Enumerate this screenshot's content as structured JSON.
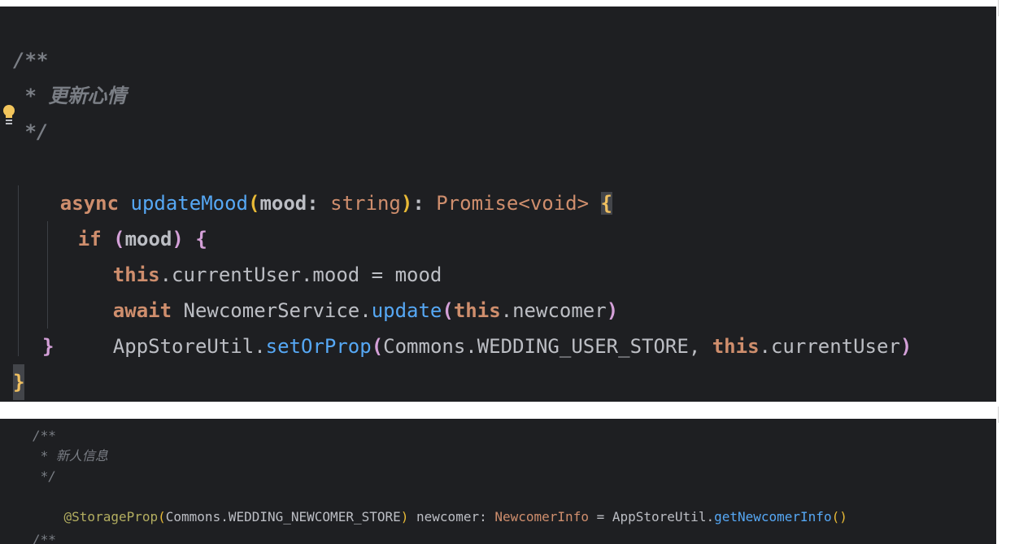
{
  "top": {
    "doc_open": "/**",
    "doc_text": " * 更新心情",
    "doc_close": " */",
    "sig": {
      "async": "async",
      "name": "updateMood",
      "open": "(",
      "param": "mood",
      "colon1": ": ",
      "ptype": "string",
      "close": ")",
      "colon2": ": ",
      "ret": "Promise<void>",
      "brace": "{"
    },
    "if_line": {
      "kw": "if",
      "open": "(",
      "cond": "mood",
      "close": ")",
      "brace": "{"
    },
    "assign": {
      "this": "this",
      "rest": ".currentUser.mood = mood"
    },
    "await_line": {
      "await": "await",
      "obj": " NewcomerService.",
      "fn": "update",
      "open": "(",
      "this": "this",
      "arg": ".newcomer",
      "close": ")"
    },
    "store_line": {
      "obj": "AppStoreUtil.",
      "fn": "setOrProp",
      "open": "(",
      "arg1": "Commons.WEDDING_USER_STORE, ",
      "this": "this",
      "arg2": ".currentUser",
      "close": ")"
    },
    "if_close": "}",
    "fn_close": "}"
  },
  "bottom": {
    "doc_open": "/**",
    "doc_text": " * 新人信息",
    "doc_close": " */",
    "decl": {
      "ann": "@StorageProp",
      "open": "(",
      "arg": "Commons.WEDDING_NEWCOMER_STORE",
      "close": ")",
      "mid": " newcomer: ",
      "type": "NewcomerInfo",
      "eq": " = AppStoreUtil.",
      "fn": "getNewcomerInfo",
      "call": "()"
    },
    "next_doc": "/**"
  },
  "colors": {
    "background": "#1e1f22",
    "keyword": "#cf8e6d",
    "function": "#56a8f5",
    "comment": "#7a7e85",
    "text": "#bcbec4"
  },
  "icons": [
    "lightbulb-icon"
  ]
}
